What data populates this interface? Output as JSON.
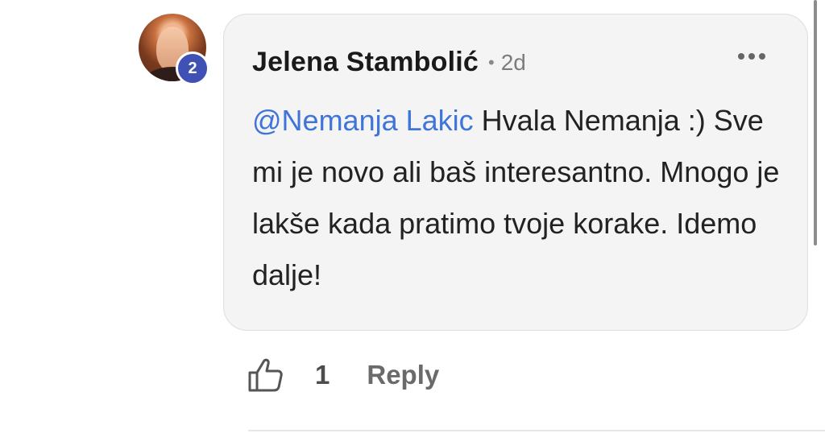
{
  "comment": {
    "author": "Jelena Stambolić",
    "separator": "•",
    "time": "2d",
    "badge": "2",
    "mention": "@Nemanja Lakic",
    "text": " Hvala Nemanja :) Sve mi je novo ali baš interesantno. Mnogo je lakše kada pratimo tvoje korake. Idemo dalje!",
    "more_icon": "more-horizontal-icon"
  },
  "actions": {
    "like_icon": "thumbs-up-icon",
    "like_count": "1",
    "reply_label": "Reply"
  },
  "colors": {
    "mention": "#3f74d8",
    "badge": "#3f51b5",
    "bubble": "#f4f4f4"
  }
}
